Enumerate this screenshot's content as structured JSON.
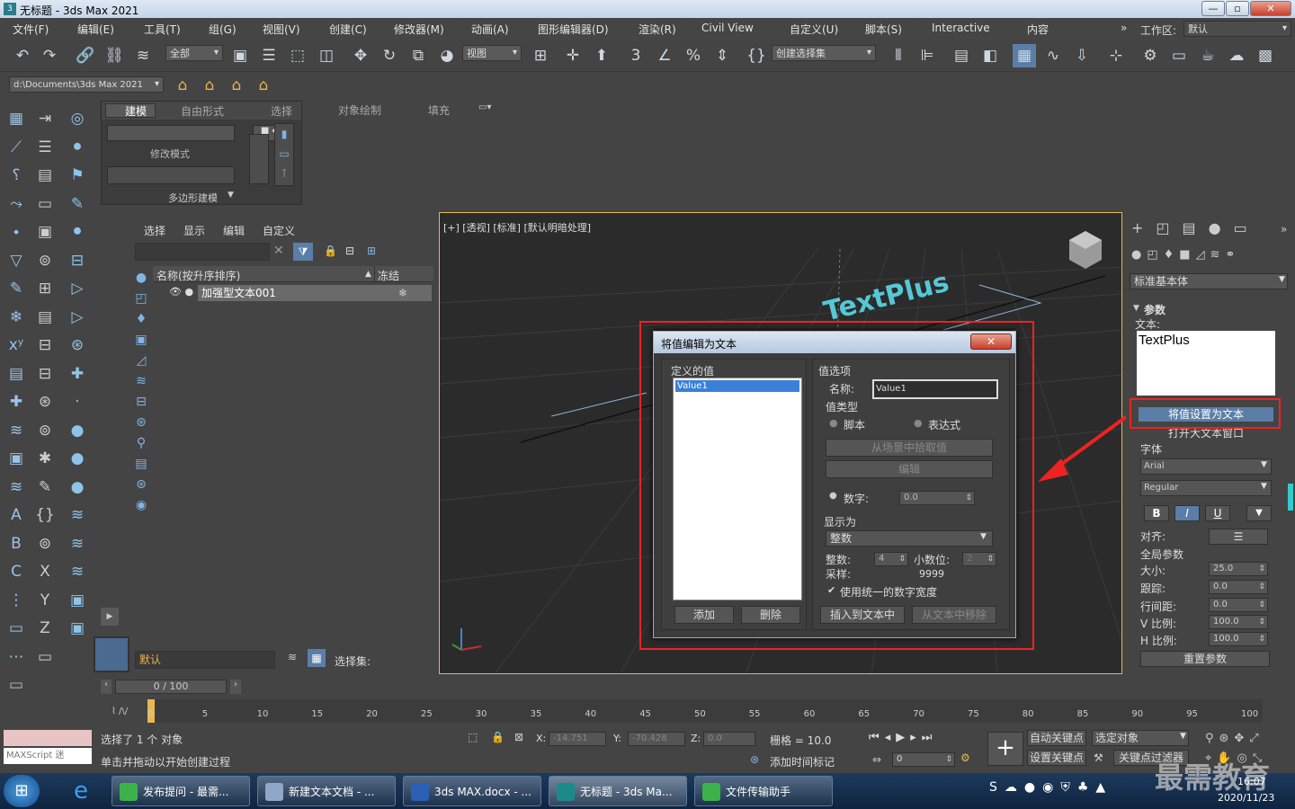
{
  "window": {
    "title": "无标题 - 3ds Max 2021",
    "app_icon": "3ds-max-icon"
  },
  "menu": [
    "文件(F)",
    "编辑(E)",
    "工具(T)",
    "组(G)",
    "视图(V)",
    "创建(C)",
    "修改器(M)",
    "动画(A)",
    "图形编辑器(D)",
    "渲染(R)",
    "Civil View",
    "自定义(U)",
    "脚本(S)",
    "Interactive",
    "内容"
  ],
  "workspace": {
    "label": "工作区:",
    "value": "默认"
  },
  "toolbar": {
    "selection_filter": "全部",
    "coord_system": "视图",
    "named_selection": "创建选择集"
  },
  "path": "d:\\Documents\\3ds Max 2021",
  "ribbon": {
    "tabs": [
      "建模",
      "自由形式",
      "选择",
      "对象绘制",
      "填充"
    ],
    "modify_mode": "修改模式",
    "poly_modeling": "多边形建模"
  },
  "explorer": {
    "tabs": [
      "选择",
      "显示",
      "编辑",
      "自定义"
    ],
    "col_name": "名称(按升序排序)",
    "col_freeze": "冻结",
    "items": [
      "加强型文本001"
    ],
    "layer": "默认",
    "selection_set_label": "选择集:"
  },
  "viewport": {
    "label": "[+] [透视] [标准] [默认明暗处理]",
    "text_obj": "TextPlus"
  },
  "dialog": {
    "title": "将值编辑为文本",
    "defined_values_label": "定义的值",
    "list": [
      "Value1"
    ],
    "options_label": "值选项",
    "name_label": "名称:",
    "name_value": "Value1",
    "type_label": "值类型",
    "radio_script": "脚本",
    "radio_expr": "表达式",
    "pick_scene": "从场景中拾取值",
    "edit": "编辑",
    "number_label": "数字:",
    "number_value": "0.0",
    "display_as": "显示为",
    "display_value": "整数",
    "integer_label": "整数:",
    "integer_value": "4",
    "decimal_label": "小数位:",
    "decimal_value": "2",
    "sample_label": "采样:",
    "sample_value": "9999",
    "uniform_width": "使用统一的数字宽度",
    "add": "添加",
    "delete": "删除",
    "insert": "插入到文本中",
    "remove": "从文本中移除"
  },
  "cmd": {
    "category": "标准基本体",
    "params": "参数",
    "text_label": "文本:",
    "text_value": "TextPlus",
    "set_value_as_text": "将值设置为文本",
    "open_big": "打开大文本窗口",
    "font_label": "字体",
    "font": "Arial",
    "style": "Regular",
    "bold": "B",
    "italic": "I",
    "underline": "U",
    "align_label": "对齐:",
    "global_params": "全局参数",
    "size_label": "大小:",
    "size": "25.0",
    "track_label": "跟踪:",
    "track": "0.0",
    "leading_label": "行间距:",
    "leading": "0.0",
    "vscale_label": "V 比例:",
    "vscale": "100.0",
    "hscale_label": "H 比例:",
    "hscale": "100.0",
    "reset": "重置参数"
  },
  "timeline": {
    "frame": "0 / 100",
    "ticks": [
      "0",
      "5",
      "10",
      "15",
      "20",
      "25",
      "30",
      "35",
      "40",
      "45",
      "50",
      "55",
      "60",
      "65",
      "70",
      "75",
      "80",
      "85",
      "90",
      "95",
      "100"
    ]
  },
  "status": {
    "maxscript": "MAXScript 迷",
    "selected": "选择了 1 个 对象",
    "prompt": "单击并拖动以开始创建过程",
    "x_label": "X:",
    "x": "-14.751",
    "y_label": "Y:",
    "y": "-70.428",
    "z_label": "Z:",
    "z": "0.0",
    "grid": "栅格 = 10.0",
    "add_time_tag": "添加时间标记",
    "auto_key": "自动关键点",
    "set_key": "设置关键点",
    "selected_obj": "选定对象",
    "key_filter": "关键点过滤器",
    "frame_field": "0"
  },
  "taskbar": {
    "tasks": [
      "发布提问 - 最需...",
      "新建文本文档 - ...",
      "3ds MAX.docx - ...",
      "无标题 - 3ds Ma...",
      "文件传输助手"
    ],
    "watermark": "最需教育",
    "clock_time": "16:07",
    "clock_date": "2020/11/23"
  }
}
